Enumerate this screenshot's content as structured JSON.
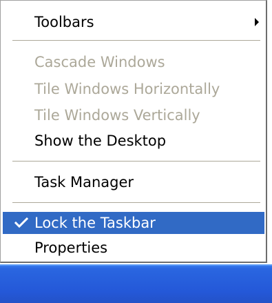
{
  "context_menu": {
    "items": [
      {
        "label": "Toolbars",
        "enabled": true,
        "has_submenu": true
      },
      {
        "label": "Cascade Windows",
        "enabled": false
      },
      {
        "label": "Tile Windows Horizontally",
        "enabled": false
      },
      {
        "label": "Tile Windows Vertically",
        "enabled": false
      },
      {
        "label": "Show the Desktop",
        "enabled": true
      },
      {
        "label": "Task Manager",
        "enabled": true
      },
      {
        "label": "Lock the Taskbar",
        "enabled": true,
        "checked": true,
        "highlighted": true
      },
      {
        "label": "Properties",
        "enabled": true
      }
    ]
  },
  "icons": {
    "submenu": "chevron-right-icon",
    "check": "checkmark-icon"
  },
  "colors": {
    "highlight": "#316ac5",
    "disabled_text": "#aca899",
    "taskbar": "#2458d8"
  }
}
